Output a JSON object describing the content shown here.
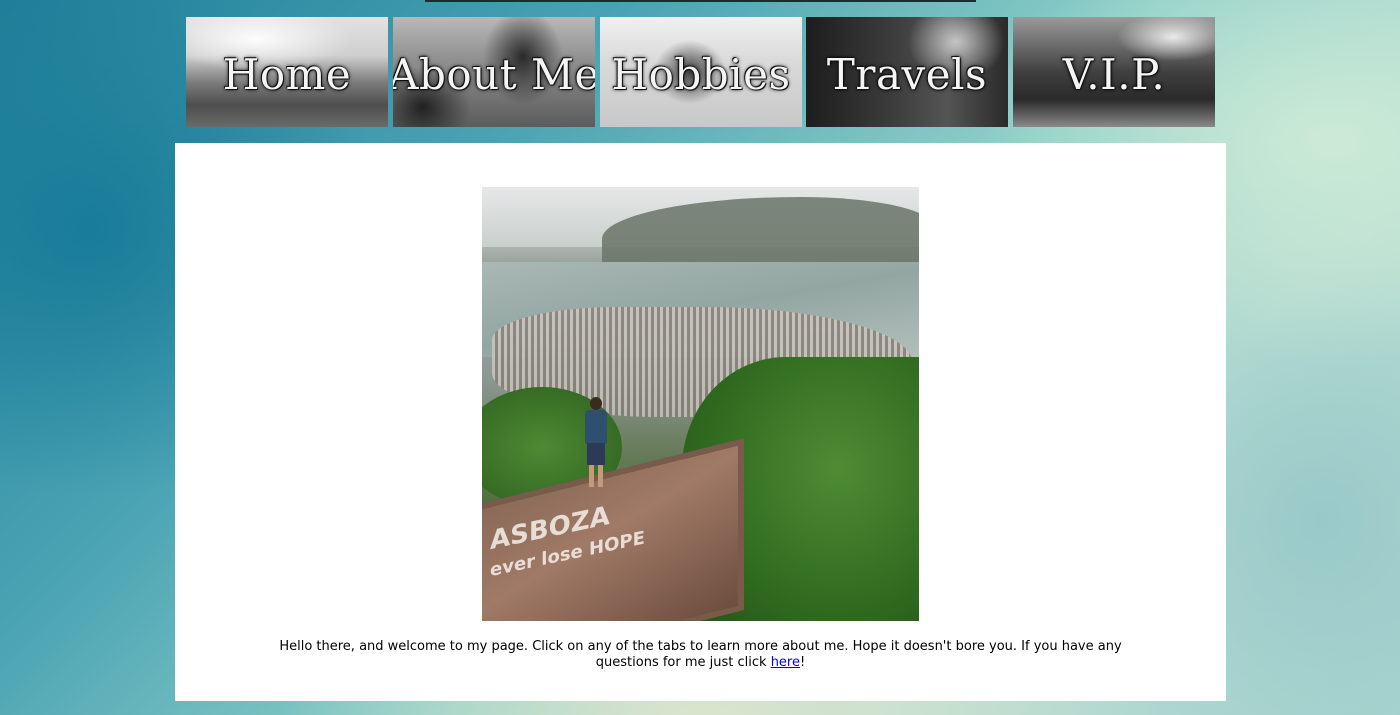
{
  "nav": {
    "tabs": [
      {
        "label": "Home"
      },
      {
        "label": "About Me"
      },
      {
        "label": "Hobbies"
      },
      {
        "label": "Travels"
      },
      {
        "label": "V.I.P."
      }
    ]
  },
  "main": {
    "photo": {
      "graffiti_line1": "ASBOZA",
      "graffiti_line2": "ever lose HOPE"
    },
    "caption": {
      "text_before": "Hello there, and welcome to my page. Click on any of the tabs to learn more about me. Hope it doesn't bore you. If you have any questions for me just click ",
      "link_text": "here",
      "text_after": "!"
    }
  }
}
